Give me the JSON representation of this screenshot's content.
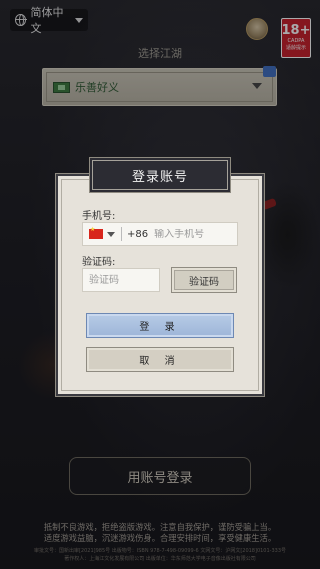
{
  "language": {
    "selected": "简体中文"
  },
  "age_badge": {
    "rating": "18+",
    "org": "CADPA",
    "tip": "适龄提示"
  },
  "server": {
    "title": "选择江湖",
    "name": "乐善好义"
  },
  "dialog": {
    "title": "登录账号",
    "phone_label": "手机号:",
    "country_code": "+86",
    "phone_placeholder": "输入手机号",
    "code_label": "验证码:",
    "code_placeholder": "验证码",
    "get_code": "验证码",
    "login": "登 录",
    "cancel": "取 消"
  },
  "account_login": "用账号登录",
  "health_notice": {
    "line1": "抵制不良游戏，拒绝盗版游戏。注意自我保护，谨防受骗上当。",
    "line2": "适度游戏益脑，沉迷游戏伤身。合理安排时间，享受健康生活。"
  },
  "legal": {
    "line1": "审批文号：国新出审[2021]985号   出版物号：ISBN 978-7-498-09099-6   文网文号：沪网文[2018]0101-333号",
    "line2": "著作权人：上海江文化发展有限公司   出版单位：华东师范大学电子音像出版社有限公司"
  }
}
